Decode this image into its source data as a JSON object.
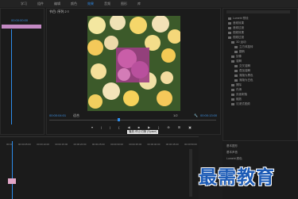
{
  "menu": {
    "tabs": [
      "学习",
      "组件",
      "编辑",
      "颜色",
      "效果",
      "音频",
      "图形",
      "库"
    ],
    "active_tab": "效果"
  },
  "sequence_panel": {
    "timecode": "00:00:00:00"
  },
  "program_monitor": {
    "title": "节目: 序列 2 ≡",
    "timecode_left": "00:00:04:01",
    "fit": "适合",
    "quality": "1/2",
    "timecode_right": "00:00:13:00",
    "tooltip": "播放-停止切换 (Space)"
  },
  "effects_panel": {
    "items": [
      "Lumetri 预设",
      "音频效果",
      "音频过渡",
      "视频效果",
      "视频过渡",
      "3D 运动",
      "立方体旋转",
      "翻转",
      "划像",
      "溶解",
      "交叉溶解",
      "叠加溶解",
      "渐隐为黑色",
      "渐隐为白色",
      "擦除",
      "内滑",
      "页面剥落",
      "缩放",
      "沉浸式视频"
    ]
  },
  "timeline": {
    "ticks": [
      "00:00",
      "00:00:05:00",
      "00:00:10:00",
      "00:00:15:00",
      "00:00:20:00",
      "00:00:25:00",
      "00:00:30:00",
      "00:00:35:00",
      "00:00:40:00",
      "00:00:45:00",
      "00:00:50:00"
    ]
  },
  "essential_panel": {
    "labels": [
      "基本图形",
      "基本声音",
      "Lumetri 颜色"
    ]
  },
  "watermark": "最需教育",
  "colors": {
    "accent": "#2d8ceb",
    "clip": "#e1a6c8",
    "watermark": "#1c5bb6"
  }
}
